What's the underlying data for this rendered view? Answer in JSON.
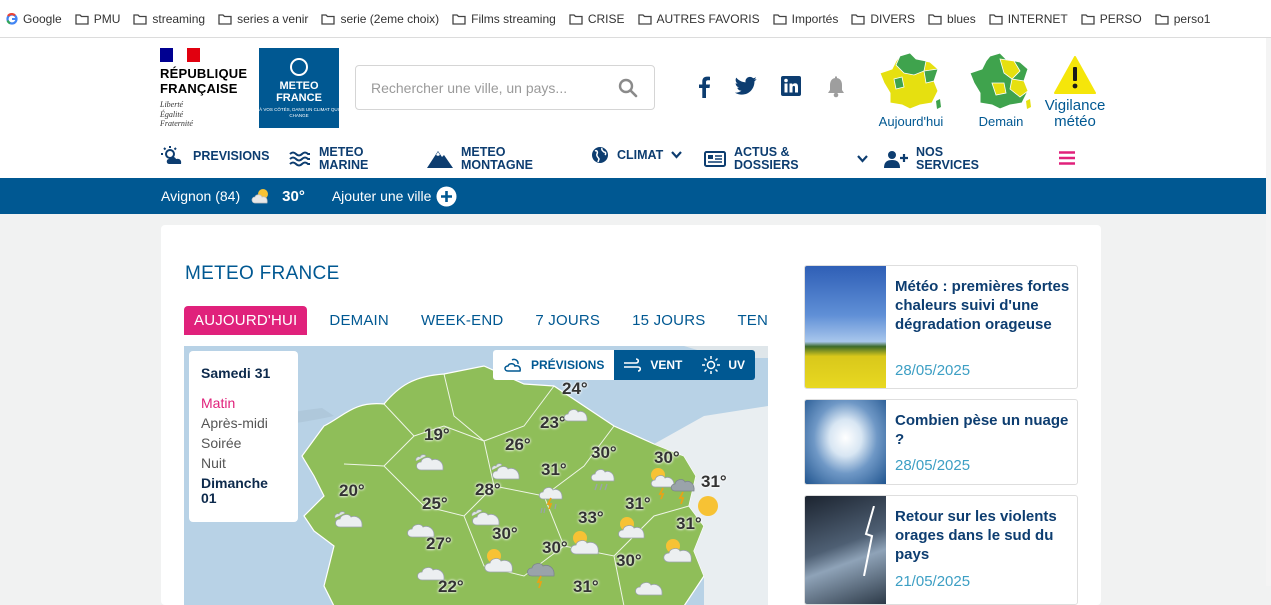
{
  "bookmarks": [
    "Google",
    "PMU",
    "streaming",
    "series a venir",
    "serie (2eme choix)",
    "Films streaming",
    "CRISE",
    "AUTRES FAVORIS",
    "Importés",
    "DIVERS",
    "blues",
    "INTERNET",
    "PERSO",
    "perso1"
  ],
  "header": {
    "rf_title_1": "RÉPUBLIQUE",
    "rf_title_2": "FRANÇAISE",
    "rf_motto_1": "Liberté",
    "rf_motto_2": "Égalité",
    "rf_motto_3": "Fraternité",
    "logo_line_1": "METEO",
    "logo_line_2": "FRANCE",
    "logo_tagline": "À VOS CÔTÉS, DANS UN CLIMAT QUI CHANGE",
    "search_placeholder": "Rechercher une ville, un pays...",
    "today_label": "Aujourd'hui",
    "tomorrow_label": "Demain",
    "vigilance_1": "Vigilance",
    "vigilance_2": "météo"
  },
  "nav": {
    "previsions": "PREVISIONS",
    "marine_1": "METEO",
    "marine_2": "MARINE",
    "montagne_1": "METEO",
    "montagne_2": "MONTAGNE",
    "climat": "CLIMAT",
    "actus_1": "ACTUS &",
    "actus_2": "DOSSIERS",
    "services_1": "NOS",
    "services_2": "SERVICES"
  },
  "city": {
    "name": "Avignon (84)",
    "temp": "30°",
    "add_label": "Ajouter une ville"
  },
  "main": {
    "title": "METEO FRANCE",
    "tabs": [
      "AUJOURD'HUI",
      "DEMAIN",
      "WEEK-END",
      "7 JOURS",
      "15 JOURS",
      "TENDANCES"
    ],
    "day_1": "Samedi 31",
    "periods": [
      "Matin",
      "Après-midi",
      "Soirée",
      "Nuit"
    ],
    "day_2_a": "Dimanche",
    "day_2_b": "01",
    "modes": [
      "PRÉVISIONS",
      "VENT",
      "UV"
    ]
  },
  "map_temps": [
    "24°",
    "23°",
    "19°",
    "26°",
    "30°",
    "31°",
    "30°",
    "31°",
    "20°",
    "28°",
    "25°",
    "31°",
    "33°",
    "31°",
    "30°",
    "27°",
    "30°",
    "30°",
    "22°",
    "31°"
  ],
  "news": [
    {
      "title": "Météo : premières fortes chaleurs suivi d'une dégradation orageuse",
      "date": "28/05/2025"
    },
    {
      "title": "Combien pèse un nuage ?",
      "date": "28/05/2025"
    },
    {
      "title": "Retour sur les violents orages dans le sud du pays",
      "date": "21/05/2025"
    }
  ],
  "colors": {
    "brand_blue": "#005892",
    "nav_text": "#0d3d70",
    "accent_pink": "#e0217b",
    "map_land": "#8fbe59",
    "date_blue": "#3d9fc4"
  }
}
